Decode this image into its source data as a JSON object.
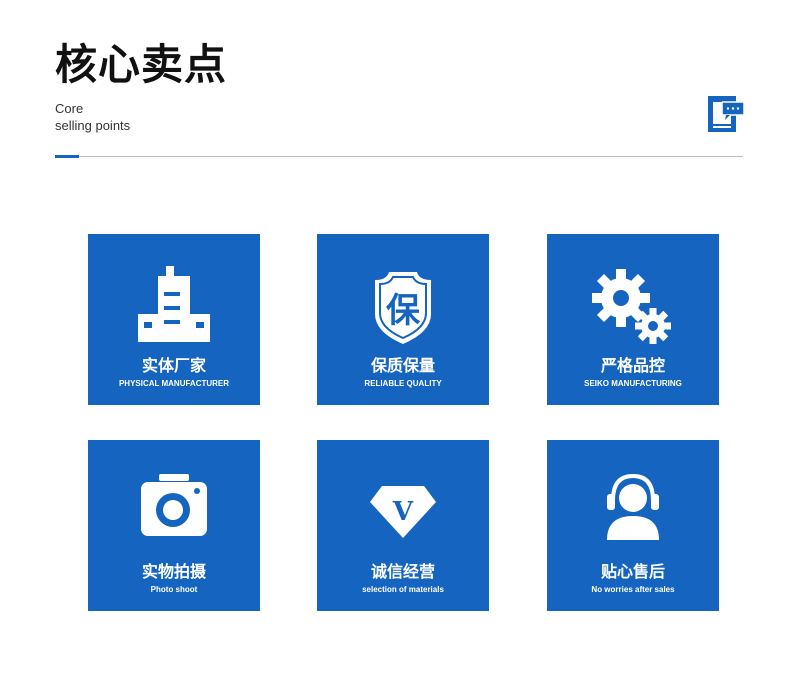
{
  "header": {
    "title": "核心卖点",
    "subtitle_line1": "Core",
    "subtitle_line2": "selling points",
    "accent_color": "#1565c0"
  },
  "cards": [
    {
      "cn": "实体厂家",
      "en": "PHYSICAL MANUFACTURER",
      "icon": "factory-icon"
    },
    {
      "cn": "保质保量",
      "en": "RELIABLE QUALITY",
      "icon": "shield-icon"
    },
    {
      "cn": "严格品控",
      "en": "SEIKO MANUFACTURING",
      "icon": "gears-icon"
    },
    {
      "cn": "实物拍摄",
      "en": "Photo shoot",
      "icon": "camera-icon"
    },
    {
      "cn": "诚信经营",
      "en": "selection of materials",
      "icon": "diamond-icon"
    },
    {
      "cn": "贴心售后",
      "en": "No worries after sales",
      "icon": "headset-icon"
    }
  ],
  "shield_char": "保",
  "diamond_char": "V"
}
